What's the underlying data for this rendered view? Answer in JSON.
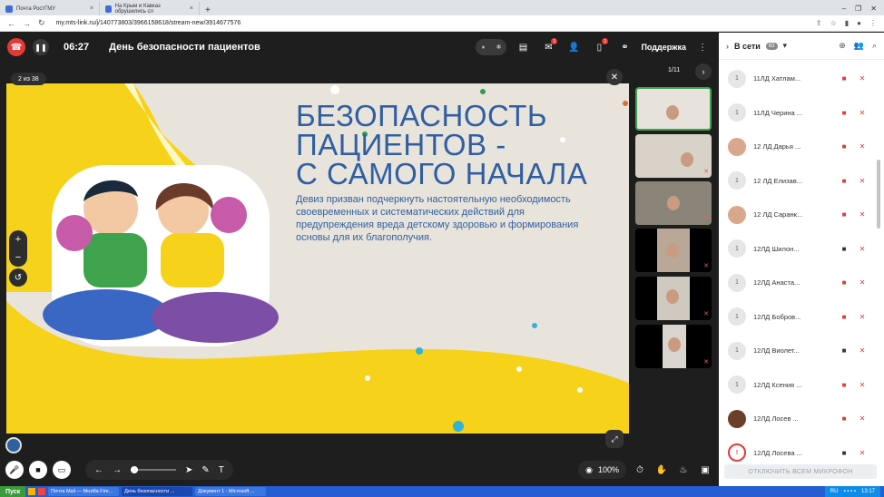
{
  "browser": {
    "tabs": [
      {
        "label": "Почта РостГМУ"
      },
      {
        "label": "На Крым и Кавказ обрушились сл"
      }
    ],
    "url": "my.mts-link.ru/j/140773803/3966158618/stream-new/3914677576"
  },
  "header": {
    "timer": "06:27",
    "title": "День безопасности пациентов",
    "chat_badge": "1",
    "files_badge": "1",
    "support_label": "Поддержка"
  },
  "slide": {
    "counter": "2 из 38",
    "heading": "БЕЗОПАСНОСТЬ\nПАЦИЕНТОВ -\nС САМОГО НАЧАЛА",
    "body": "Девиз призван подчеркнуть настоятельную необходимость своевременных и систематических действий для предупреждения вреда детскому здоровью и формирования основы для их благополучия."
  },
  "videos": {
    "page": "1/11"
  },
  "toolbar": {
    "zoom": "100%"
  },
  "panel": {
    "title": "В сети",
    "count": "63",
    "mute_all_label": "ОТКЛЮЧИТЬ ВСЕМ МИКРОФОН",
    "participants": [
      {
        "avatar": "1",
        "name": "11ЛД Хатлам...",
        "cam": "off"
      },
      {
        "avatar": "1",
        "name": "11ЛД Черина ...",
        "cam": "off"
      },
      {
        "avatar": "",
        "name": "12 ЛД Дарья ...",
        "cam": "off"
      },
      {
        "avatar": "1",
        "name": "12 ЛД Елизав...",
        "cam": "off"
      },
      {
        "avatar": "",
        "name": "12 ЛД Саранк...",
        "cam": "off"
      },
      {
        "avatar": "1",
        "name": "12ЛД Шилон...",
        "cam": "on"
      },
      {
        "avatar": "1",
        "name": "12ЛД Анаста...",
        "cam": "off"
      },
      {
        "avatar": "1",
        "name": "12ЛД Бобров...",
        "cam": "off"
      },
      {
        "avatar": "1",
        "name": "12ЛД Виолет...",
        "cam": "on"
      },
      {
        "avatar": "1",
        "name": "12ЛД Ксения ...",
        "cam": "off"
      },
      {
        "avatar": "",
        "name": "12ЛД Лосев ...",
        "cam": "off"
      },
      {
        "avatar": "!",
        "name": "12ЛД Лосева ...",
        "cam": "on"
      }
    ]
  },
  "taskbar": {
    "start": "Пуск",
    "tasks": [
      {
        "label": "Почта Mail — Mozilla Fire..."
      },
      {
        "label": "День безопасности ..."
      },
      {
        "label": "Документ 1 - Microsoft ..."
      }
    ],
    "lang": "RU",
    "time": "13:17"
  }
}
